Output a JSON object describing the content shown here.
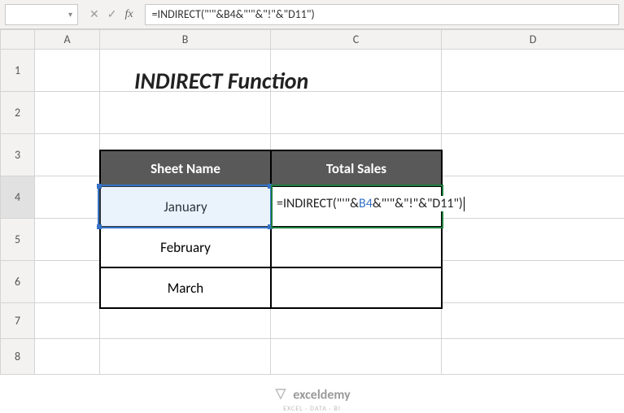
{
  "toolbar": {
    "name_box": "",
    "cancel_icon": "✕",
    "confirm_icon": "✓",
    "fx_label": "fx",
    "formula": "=INDIRECT(\"'\"&B4&\"'\"&\"!\"&\"D11\")"
  },
  "columns": [
    "A",
    "B",
    "C",
    "D"
  ],
  "rows": [
    "1",
    "2",
    "3",
    "4",
    "5",
    "6",
    "7",
    "8"
  ],
  "title": "INDIRECT Function",
  "table": {
    "headers": {
      "sheet_name": "Sheet Name",
      "total_sales": "Total Sales"
    },
    "rows": [
      {
        "sheet": "January",
        "sales": ""
      },
      {
        "sheet": "February",
        "sales": ""
      },
      {
        "sheet": "March",
        "sales": ""
      }
    ]
  },
  "editing": {
    "cell": "C4",
    "formula_prefix": "=INDIRECT(\"'\"&",
    "formula_ref": "B4",
    "formula_suffix": "&\"'\"&\"!\"&\"D11\")"
  },
  "watermark": {
    "brand": "exceldemy",
    "sub": "EXCEL · DATA · BI"
  }
}
